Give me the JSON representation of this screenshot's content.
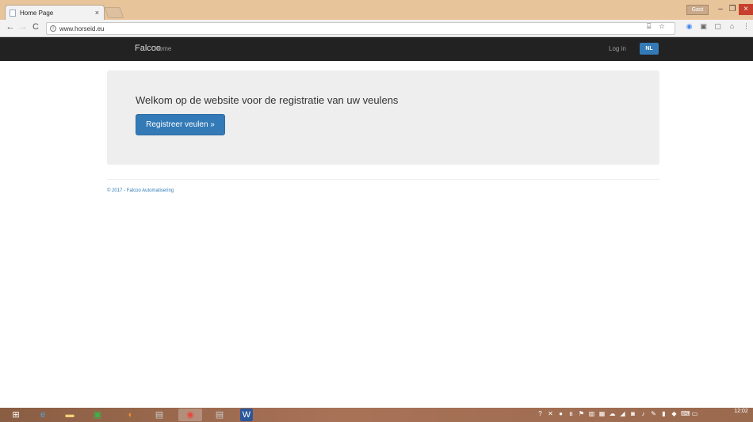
{
  "browser": {
    "tab_title": "Home Page",
    "tab_close": "×",
    "user_label": "Gast",
    "window_controls": {
      "minimize": "–",
      "maximize": "❐",
      "close": "×"
    },
    "url": "www.horseid.eu",
    "icons": [
      "back-arrow-icon",
      "forward-arrow-icon",
      "reload-icon",
      "info-icon",
      "translate-icon",
      "star-icon",
      "extension-icon"
    ]
  },
  "navbar": {
    "brand": "Falcoo",
    "home": "Home",
    "login": "Log in",
    "language": "NL"
  },
  "jumbotron": {
    "welcome": "Welkom op de website voor de registratie van uw veulens",
    "button": "Registreer veulen »"
  },
  "footer": {
    "text": "© 2017 - Falcoo Automatisering"
  },
  "taskbar": {
    "time": "12:02",
    "colors": {
      "accent": "#337ab7",
      "navbar": "#222222",
      "jumbotron": "#eeeeee"
    }
  }
}
